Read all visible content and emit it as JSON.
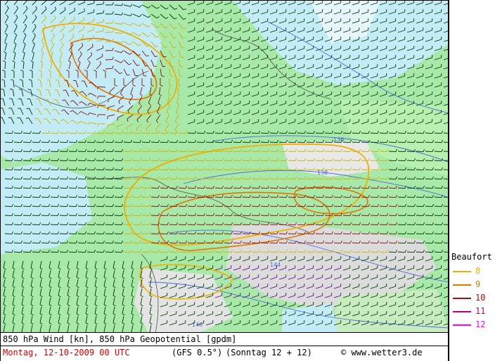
{
  "map": {
    "contour_labels": [
      "136",
      "138",
      "144",
      "146"
    ]
  },
  "legend": {
    "title": "Beaufort",
    "items": [
      {
        "label": "8",
        "color": "#f0b000"
      },
      {
        "label": "9",
        "color": "#e07800"
      },
      {
        "label": "10",
        "color": "#a01010"
      },
      {
        "label": "11",
        "color": "#c00080"
      },
      {
        "label": "12",
        "color": "#ff00ff"
      }
    ]
  },
  "footer": {
    "line1": "850 hPa Wind [kn], 850 hPa Geopotential [gpdm]",
    "date": "Montag, 12-10-2009  00 UTC",
    "model": "(GFS 0.5°)",
    "run": "(Sonntag 12 + 12)",
    "copyright": "© www.wetter3.de"
  },
  "colors": {
    "land_green": "#8ee88e",
    "sea_blue": "#b8e4f4",
    "mountain_grey": "#d8d8d8",
    "barb_green": "#003300",
    "barb_yellow": "#c8b400",
    "barb_red": "#801010",
    "barb_purple": "#5a0080"
  }
}
